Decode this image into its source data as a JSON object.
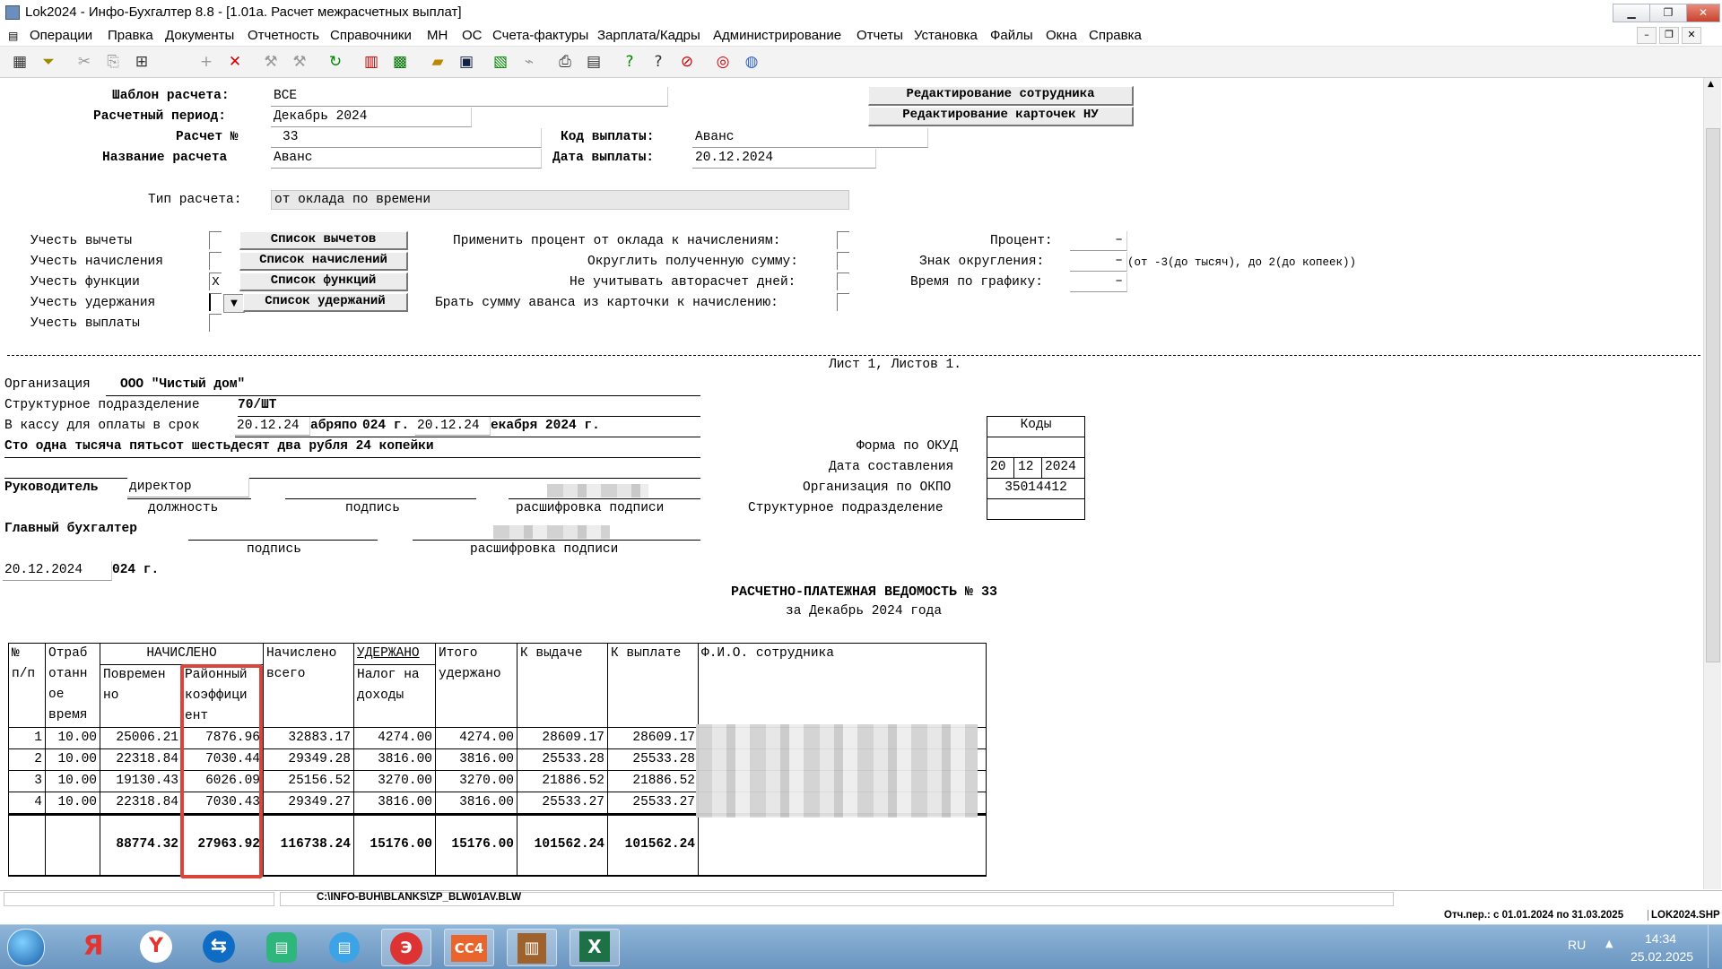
{
  "window": {
    "title": "Lok2024 - Инфо-Бухгалтер 8.8 - [1.01а. Расчет межрасчетных выплат]"
  },
  "menu": [
    "Операции",
    "Правка",
    "Документы",
    "Отчетность",
    "Справочники",
    "МН",
    "ОС",
    "Счета-фактуры",
    "Зарплата/Кадры",
    "Администрирование",
    "Отчеты",
    "Установка",
    "Файлы",
    "Окна",
    "Справка"
  ],
  "form": {
    "template_label": "Шаблон расчета:",
    "template_value": "ВСЕ",
    "period_label": "Расчетный период:",
    "period_value": "Декабрь 2024",
    "calc_no_label": "Расчет №",
    "calc_no_value": "33",
    "name_label": "Название расчета",
    "name_value": "Аванс",
    "paycode_label": "Код выплаты:",
    "paycode_value": "Аванс",
    "paydate_label": "Дата выплаты:",
    "paydate_value": "20.12.2024",
    "type_label": "Тип расчета:",
    "type_value": "от оклада по времени",
    "btn_edit_employee": "Редактирование сотрудника",
    "btn_edit_card": "Редактирование карточек НУ",
    "opt_deductions": "Учесть вычеты",
    "opt_accruals": "Учесть начисления",
    "opt_functions": "Учесть функции",
    "opt_withholdings": "Учесть удержания",
    "opt_payments": "Учесть выплаты",
    "chk_functions_value": "X",
    "btn_deductions": "Список вычетов",
    "btn_accruals": "Список начислений",
    "btn_functions": "Список функций",
    "btn_withholdings": "Список удержаний",
    "apply_percent_label": "Применить процент от оклада к начислениям:",
    "round_label": "Округлить полученную сумму:",
    "ignore_auto_label": "Не учитывать авторасчет дней:",
    "take_advance_label": "Брать сумму аванса из карточки к начислению:",
    "percent_label": "Процент:",
    "round_sign_label": "Знак округления:",
    "round_hint": "(от -3(до тысяч), до 2(до копеек))",
    "schedule_label": "Время по графику:",
    "dash": "–"
  },
  "report": {
    "sheet": "Лист 1, Листов 1.",
    "org_label": "Организация",
    "org_value": "ООО \"Чистый дом\"",
    "dept_label": "Структурное подразделение",
    "dept_value": "70/ШТ",
    "cash_label": "В кассу для оплаты в срок",
    "cash_from": "20.12.24",
    "cash_mid1": "абряпо",
    "cash_mid2": "024 г.",
    "cash_to": "20.12.24",
    "cash_tail": "екабря 2024 г.",
    "amount_words": "Сто одна тысяча пятьсот шестьдесят два рубля 24 копейки",
    "head_label": "Руководитель",
    "head_position": "директор",
    "sig_position": "должность",
    "sig_sign": "подпись",
    "sig_decode": "расшифровка подписи",
    "chief_acc_label": "Главный бухгалтер",
    "date_value": "20.12.2024",
    "date_tail": "024 г.",
    "codes_header": "Коды",
    "okud_label": "Форма по ОКУД",
    "date_comp_label": "Дата составления",
    "date_d": "20",
    "date_m": "12",
    "date_y": "2024",
    "okpo_label": "Организация по ОКПО",
    "okpo_value": "35014412",
    "struct_label": "Структурное подразделение",
    "title": "РАСЧЕТНО-ПЛАТЕЖНАЯ ВЕДОМОСТЬ № 33",
    "subtitle": "за Декабрь 2024 года"
  },
  "table": {
    "h_no": "№",
    "h_pp": "п/п",
    "h_worked_1": "Отраб",
    "h_worked_2": "отанн",
    "h_worked_3": "ое",
    "h_worked_4": "время",
    "h_accrued": "НАЧИСЛЕНО",
    "h_time_1": "Повремен",
    "h_time_2": "но",
    "h_rk_1": "Районный",
    "h_rk_2": "коэффици",
    "h_rk_3": "ент",
    "h_total_acc": "Начислено",
    "h_total_acc2": "всего",
    "h_withheld": "УДЕРЖАНО",
    "h_tax_1": "Налог на",
    "h_tax_2": "доходы",
    "h_total_with_1": "Итого",
    "h_total_with_2": "удержано",
    "h_issue": "К выдаче",
    "h_pay": "К выплате",
    "h_fio": "Ф.И.О. сотрудника",
    "rows": [
      [
        "1",
        "10.00",
        "25006.21",
        "7876.96",
        "32883.17",
        "4274.00",
        "4274.00",
        "28609.17",
        "28609.17"
      ],
      [
        "2",
        "10.00",
        "22318.84",
        "7030.44",
        "29349.28",
        "3816.00",
        "3816.00",
        "25533.28",
        "25533.28"
      ],
      [
        "3",
        "10.00",
        "19130.43",
        "6026.09",
        "25156.52",
        "3270.00",
        "3270.00",
        "21886.52",
        "21886.52"
      ],
      [
        "4",
        "10.00",
        "22318.84",
        "7030.43",
        "29349.27",
        "3816.00",
        "3816.00",
        "25533.27",
        "25533.27"
      ]
    ],
    "totals": [
      "88774.32",
      "27963.92",
      "116738.24",
      "15176.00",
      "15176.00",
      "101562.24",
      "101562.24"
    ]
  },
  "status": {
    "path": "C:\\INFO-BUH\\BLANKS\\ZP_BLW01AV.BLW",
    "period": "Отч.пер.: с 01.01.2024 по 31.03.2025",
    "file": "LOK2024.SHP"
  },
  "taskbar": {
    "lang": "RU",
    "time": "14:34",
    "date": "25.02.2025"
  },
  "colors": {
    "highlight": "#d9453b",
    "taskbar": "#7aa3cc"
  }
}
